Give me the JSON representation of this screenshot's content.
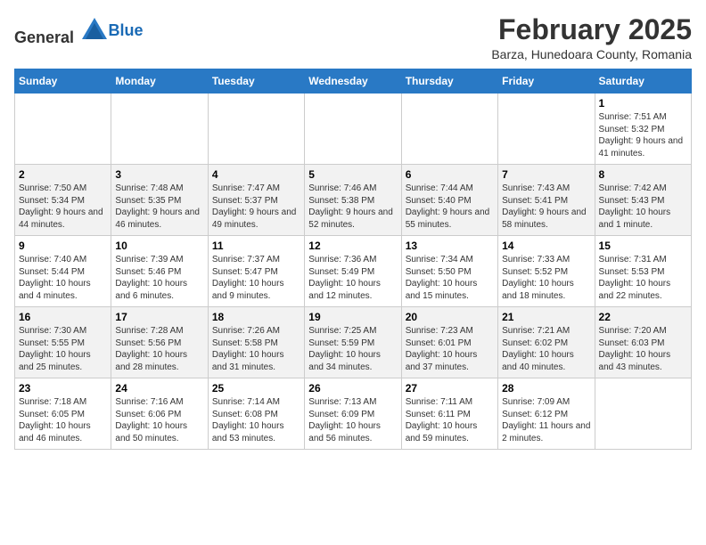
{
  "app": {
    "name_general": "General",
    "name_blue": "Blue"
  },
  "header": {
    "month_title": "February 2025",
    "location": "Barza, Hunedoara County, Romania"
  },
  "weekdays": [
    "Sunday",
    "Monday",
    "Tuesday",
    "Wednesday",
    "Thursday",
    "Friday",
    "Saturday"
  ],
  "weeks": [
    [
      {
        "day": "",
        "info": ""
      },
      {
        "day": "",
        "info": ""
      },
      {
        "day": "",
        "info": ""
      },
      {
        "day": "",
        "info": ""
      },
      {
        "day": "",
        "info": ""
      },
      {
        "day": "",
        "info": ""
      },
      {
        "day": "1",
        "info": "Sunrise: 7:51 AM\nSunset: 5:32 PM\nDaylight: 9 hours and 41 minutes."
      }
    ],
    [
      {
        "day": "2",
        "info": "Sunrise: 7:50 AM\nSunset: 5:34 PM\nDaylight: 9 hours and 44 minutes."
      },
      {
        "day": "3",
        "info": "Sunrise: 7:48 AM\nSunset: 5:35 PM\nDaylight: 9 hours and 46 minutes."
      },
      {
        "day": "4",
        "info": "Sunrise: 7:47 AM\nSunset: 5:37 PM\nDaylight: 9 hours and 49 minutes."
      },
      {
        "day": "5",
        "info": "Sunrise: 7:46 AM\nSunset: 5:38 PM\nDaylight: 9 hours and 52 minutes."
      },
      {
        "day": "6",
        "info": "Sunrise: 7:44 AM\nSunset: 5:40 PM\nDaylight: 9 hours and 55 minutes."
      },
      {
        "day": "7",
        "info": "Sunrise: 7:43 AM\nSunset: 5:41 PM\nDaylight: 9 hours and 58 minutes."
      },
      {
        "day": "8",
        "info": "Sunrise: 7:42 AM\nSunset: 5:43 PM\nDaylight: 10 hours and 1 minute."
      }
    ],
    [
      {
        "day": "9",
        "info": "Sunrise: 7:40 AM\nSunset: 5:44 PM\nDaylight: 10 hours and 4 minutes."
      },
      {
        "day": "10",
        "info": "Sunrise: 7:39 AM\nSunset: 5:46 PM\nDaylight: 10 hours and 6 minutes."
      },
      {
        "day": "11",
        "info": "Sunrise: 7:37 AM\nSunset: 5:47 PM\nDaylight: 10 hours and 9 minutes."
      },
      {
        "day": "12",
        "info": "Sunrise: 7:36 AM\nSunset: 5:49 PM\nDaylight: 10 hours and 12 minutes."
      },
      {
        "day": "13",
        "info": "Sunrise: 7:34 AM\nSunset: 5:50 PM\nDaylight: 10 hours and 15 minutes."
      },
      {
        "day": "14",
        "info": "Sunrise: 7:33 AM\nSunset: 5:52 PM\nDaylight: 10 hours and 18 minutes."
      },
      {
        "day": "15",
        "info": "Sunrise: 7:31 AM\nSunset: 5:53 PM\nDaylight: 10 hours and 22 minutes."
      }
    ],
    [
      {
        "day": "16",
        "info": "Sunrise: 7:30 AM\nSunset: 5:55 PM\nDaylight: 10 hours and 25 minutes."
      },
      {
        "day": "17",
        "info": "Sunrise: 7:28 AM\nSunset: 5:56 PM\nDaylight: 10 hours and 28 minutes."
      },
      {
        "day": "18",
        "info": "Sunrise: 7:26 AM\nSunset: 5:58 PM\nDaylight: 10 hours and 31 minutes."
      },
      {
        "day": "19",
        "info": "Sunrise: 7:25 AM\nSunset: 5:59 PM\nDaylight: 10 hours and 34 minutes."
      },
      {
        "day": "20",
        "info": "Sunrise: 7:23 AM\nSunset: 6:01 PM\nDaylight: 10 hours and 37 minutes."
      },
      {
        "day": "21",
        "info": "Sunrise: 7:21 AM\nSunset: 6:02 PM\nDaylight: 10 hours and 40 minutes."
      },
      {
        "day": "22",
        "info": "Sunrise: 7:20 AM\nSunset: 6:03 PM\nDaylight: 10 hours and 43 minutes."
      }
    ],
    [
      {
        "day": "23",
        "info": "Sunrise: 7:18 AM\nSunset: 6:05 PM\nDaylight: 10 hours and 46 minutes."
      },
      {
        "day": "24",
        "info": "Sunrise: 7:16 AM\nSunset: 6:06 PM\nDaylight: 10 hours and 50 minutes."
      },
      {
        "day": "25",
        "info": "Sunrise: 7:14 AM\nSunset: 6:08 PM\nDaylight: 10 hours and 53 minutes."
      },
      {
        "day": "26",
        "info": "Sunrise: 7:13 AM\nSunset: 6:09 PM\nDaylight: 10 hours and 56 minutes."
      },
      {
        "day": "27",
        "info": "Sunrise: 7:11 AM\nSunset: 6:11 PM\nDaylight: 10 hours and 59 minutes."
      },
      {
        "day": "28",
        "info": "Sunrise: 7:09 AM\nSunset: 6:12 PM\nDaylight: 11 hours and 2 minutes."
      },
      {
        "day": "",
        "info": ""
      }
    ]
  ]
}
